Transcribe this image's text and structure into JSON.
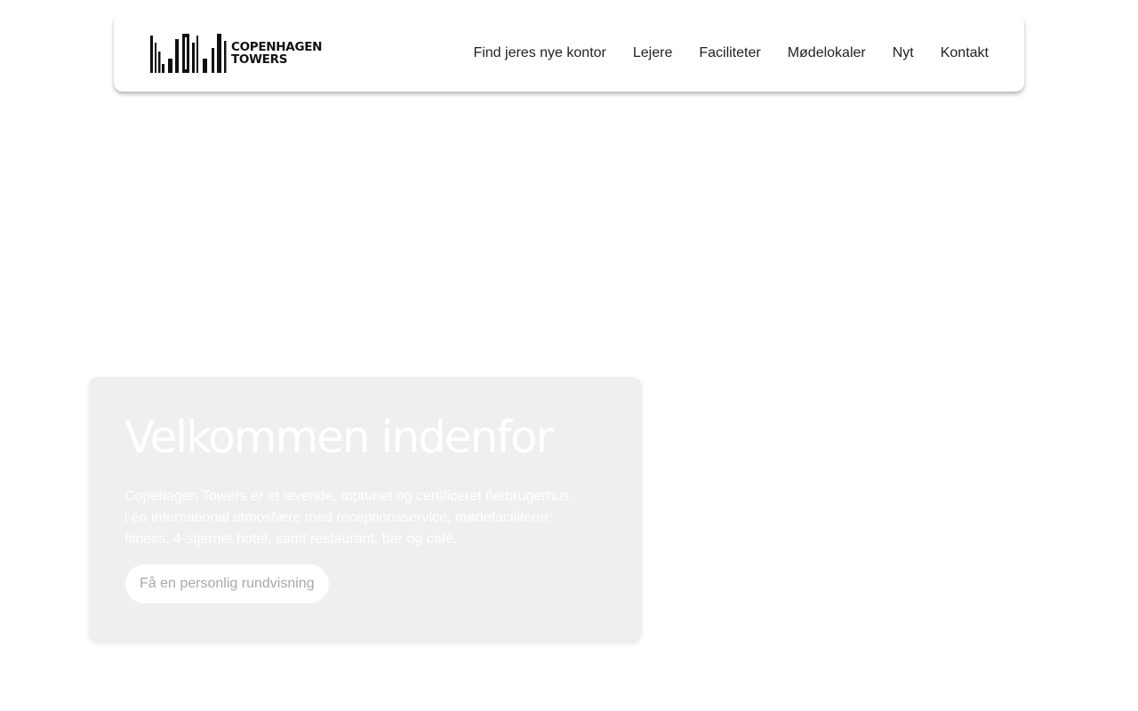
{
  "header": {
    "logo": {
      "line1": "COPENHAGEN",
      "line2": "TOWERS"
    },
    "nav": [
      {
        "label": "Find jeres nye kontor"
      },
      {
        "label": "Lejere"
      },
      {
        "label": "Faciliteter"
      },
      {
        "label": "Mødelokaler"
      },
      {
        "label": "Nyt"
      },
      {
        "label": "Kontakt"
      }
    ]
  },
  "hero": {
    "title": "Velkommen indenfor",
    "text": "Copehagen Towers er et levende, toptunet og certificeret flerbrugerhus i en international atmosfære med receptionsservice, mødefaciliterer, fitness, 4-stjernet hotel, samt restaurant, bar og café.",
    "cta_label": "Få en personlig rundvisning"
  },
  "colors": {
    "card_background": "#efefef",
    "nav_text": "#222222",
    "button_text": "#a8a8a8"
  }
}
